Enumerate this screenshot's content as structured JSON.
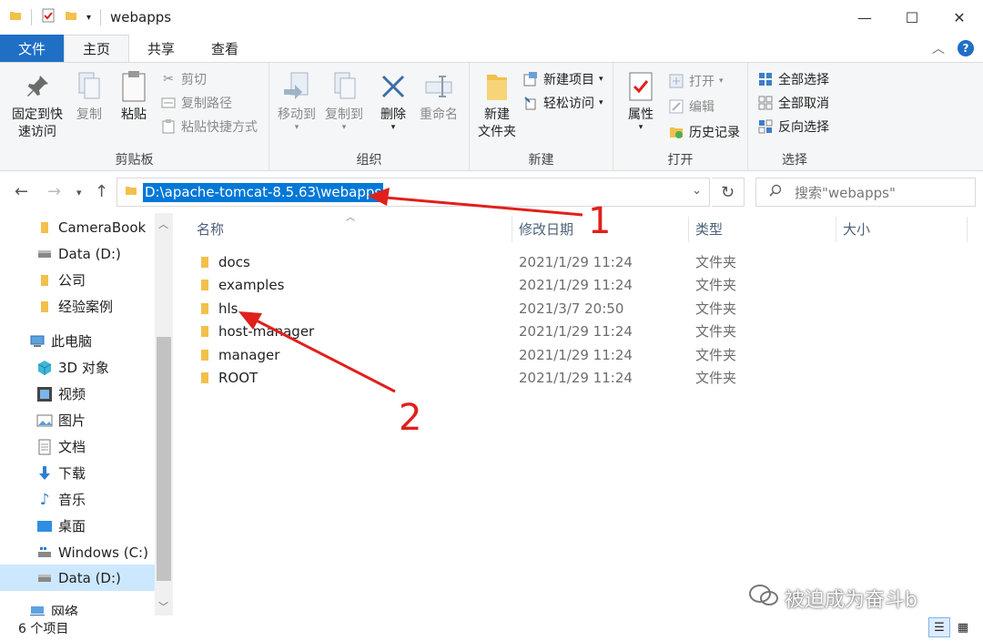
{
  "window": {
    "title": "webapps"
  },
  "colors": {
    "file_tab": "#1f6fc5",
    "accent": "#0078d7",
    "folder": "#f2c04c",
    "annotation": "#e0201b"
  },
  "ribbon_tabs": [
    {
      "label": "文件"
    },
    {
      "label": "主页"
    },
    {
      "label": "共享"
    },
    {
      "label": "查看"
    }
  ],
  "ribbon": {
    "clipboard": {
      "label": "剪贴板",
      "pin": "固定到快速访问",
      "pin_l1": "固定到快",
      "pin_l2": "速访问",
      "copy": "复制",
      "paste": "粘贴",
      "cut": "剪切",
      "copy_path": "复制路径",
      "paste_shortcut": "粘贴快捷方式"
    },
    "organize": {
      "label": "组织",
      "move_to": "移动到",
      "copy_to": "复制到",
      "delete": "删除",
      "rename": "重命名"
    },
    "new": {
      "label": "新建",
      "new_folder_l1": "新建",
      "new_folder_l2": "文件夹",
      "new_item": "新建项目",
      "easy_access": "轻松访问"
    },
    "open": {
      "label": "打开",
      "properties": "属性",
      "open": "打开",
      "edit": "编辑",
      "history": "历史记录"
    },
    "select": {
      "label": "选择",
      "select_all": "全部选择",
      "select_none": "全部取消",
      "invert": "反向选择"
    }
  },
  "address": {
    "path": "D:\\apache-tomcat-8.5.63\\webapps"
  },
  "search": {
    "placeholder": "搜索\"webapps\""
  },
  "nav": {
    "items": [
      {
        "label": "CameraBook",
        "icon": "folder-icon"
      },
      {
        "label": "Data (D:)",
        "icon": "drive-icon"
      },
      {
        "label": "公司",
        "icon": "folder-icon"
      },
      {
        "label": "经验案例",
        "icon": "folder-icon"
      },
      {
        "label": "此电脑",
        "icon": "computer-icon"
      },
      {
        "label": "3D 对象",
        "icon": "cube-icon"
      },
      {
        "label": "视频",
        "icon": "video-icon"
      },
      {
        "label": "图片",
        "icon": "picture-icon"
      },
      {
        "label": "文档",
        "icon": "document-icon"
      },
      {
        "label": "下载",
        "icon": "download-icon"
      },
      {
        "label": "音乐",
        "icon": "music-icon"
      },
      {
        "label": "桌面",
        "icon": "desktop-icon"
      },
      {
        "label": "Windows (C:)",
        "icon": "drive-icon"
      },
      {
        "label": "Data (D:)",
        "icon": "drive-icon"
      },
      {
        "label": "网络",
        "icon": "network-icon"
      }
    ]
  },
  "columns": {
    "name": "名称",
    "date": "修改日期",
    "type": "类型",
    "size": "大小"
  },
  "files": [
    {
      "name": "docs",
      "date": "2021/1/29 11:24",
      "type": "文件夹"
    },
    {
      "name": "examples",
      "date": "2021/1/29 11:24",
      "type": "文件夹"
    },
    {
      "name": "hls",
      "date": "2021/3/7 20:50",
      "type": "文件夹"
    },
    {
      "name": "host-manager",
      "date": "2021/1/29 11:24",
      "type": "文件夹"
    },
    {
      "name": "manager",
      "date": "2021/1/29 11:24",
      "type": "文件夹"
    },
    {
      "name": "ROOT",
      "date": "2021/1/29 11:24",
      "type": "文件夹"
    }
  ],
  "status": {
    "count": "6 个项目"
  },
  "annotations": {
    "one": "1",
    "two": "2"
  },
  "watermark": {
    "text": "被迫成为奋斗b"
  }
}
